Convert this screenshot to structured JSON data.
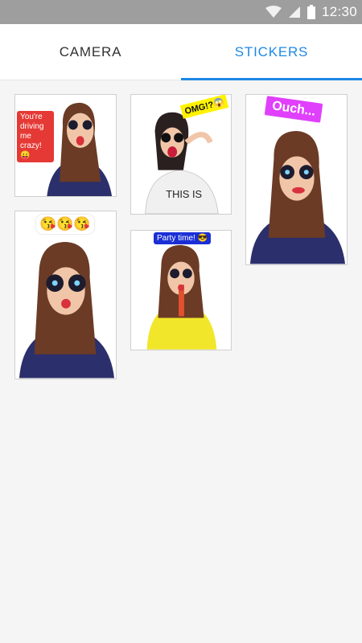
{
  "status_bar": {
    "time": "12:30",
    "icons": [
      "wifi-icon",
      "signal-icon",
      "battery-icon"
    ]
  },
  "tabs": [
    {
      "label": "CAMERA",
      "active": false
    },
    {
      "label": "STICKERS",
      "active": true
    }
  ],
  "colors": {
    "accent": "#1e88e5",
    "status_bar": "#9e9e9e",
    "background": "#f5f5f5"
  },
  "stickers": [
    {
      "caption": "You're driving me crazy! 😛",
      "image": "girl-sticking-tongue-out"
    },
    {
      "caption": "OMG!?😱",
      "image": "girl-screaming-this-is-shirt"
    },
    {
      "caption": "Ouch...",
      "image": "girl-biting-lip"
    },
    {
      "caption": "😘😘😘",
      "image": "girl-blowing-kiss"
    },
    {
      "caption": "Party time! 😎",
      "image": "girl-yellow-sweater-drink"
    }
  ]
}
